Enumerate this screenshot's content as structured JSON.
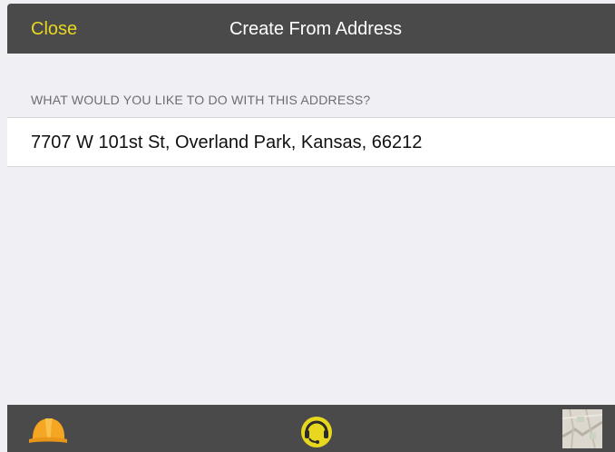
{
  "navbar": {
    "close_label": "Close",
    "title": "Create From Address"
  },
  "section": {
    "header": "WHAT WOULD YOU LIKE TO DO WITH THIS ADDRESS?",
    "address": "7707 W 101st St, Overland Park, Kansas, 66212"
  },
  "toolbar": {
    "items": [
      {
        "icon": "hardhat-icon"
      },
      {
        "icon": "location-headset-icon"
      },
      {
        "icon": "map-thumbnail-icon"
      }
    ]
  },
  "colors": {
    "bar_background": "#4a4a4a",
    "accent_yellow": "#e8d71f",
    "hardhat_orange": "#f5a623",
    "page_background": "#efeff4"
  }
}
